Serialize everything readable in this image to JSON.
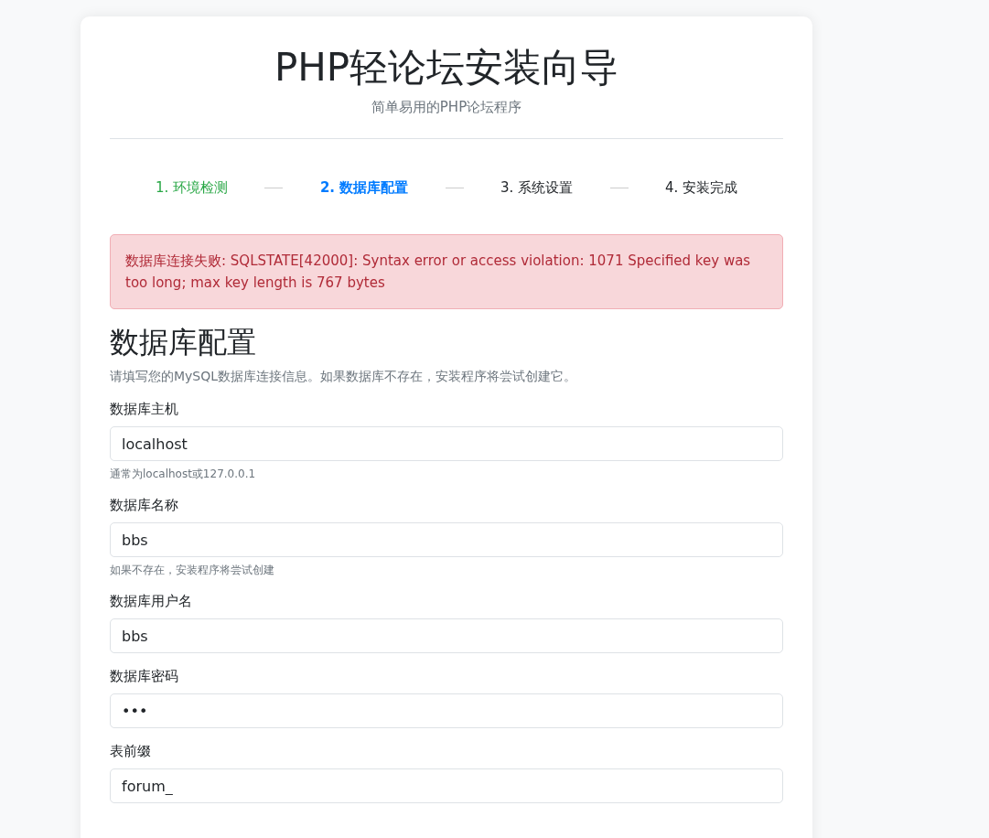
{
  "header": {
    "title": "PHP轻论坛安装向导",
    "subtitle": "简单易用的PHP论坛程序"
  },
  "steps": [
    {
      "label": "1. 环境检测",
      "kind": "done",
      "selected": false
    },
    {
      "label": "2. 数据库配置",
      "kind": "active",
      "selected": true
    },
    {
      "label": "3. 系统设置",
      "kind": "pending",
      "selected": false
    },
    {
      "label": "4. 安装完成",
      "kind": "pending",
      "selected": false
    }
  ],
  "alert": {
    "kind": "error",
    "text": "数据库连接失败: SQLSTATE[42000]: Syntax error or access violation: 1071 Specified key was too long; max key length is 767 bytes"
  },
  "section": {
    "heading": "数据库配置",
    "description": "请填写您的MySQL数据库连接信息。如果数据库不存在，安装程序将尝试创建它。"
  },
  "fields": [
    {
      "label": "数据库主机",
      "value": "localhost",
      "help": "通常为localhost或127.0.0.1"
    },
    {
      "label": "数据库名称",
      "value": "bbs",
      "help": "如果不存在，安装程序将尝试创建"
    },
    {
      "label": "数据库用户名",
      "value": "bbs"
    },
    {
      "label": "数据库密码",
      "value": "•••"
    },
    {
      "label": "表前缀",
      "value": "forum_"
    }
  ]
}
